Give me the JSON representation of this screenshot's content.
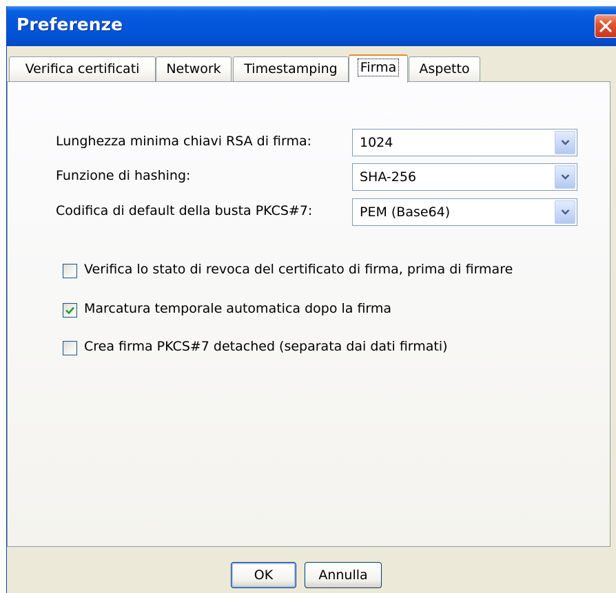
{
  "window": {
    "title": "Preferenze"
  },
  "tabs": [
    {
      "label": "Verifica certificati",
      "active": false
    },
    {
      "label": "Network",
      "active": false
    },
    {
      "label": "Timestamping",
      "active": false
    },
    {
      "label": "Firma",
      "active": true
    },
    {
      "label": "Aspetto",
      "active": false
    }
  ],
  "form": {
    "rsa_min_length": {
      "label": "Lunghezza minima chiavi RSA di firma:",
      "value": "1024"
    },
    "hashing": {
      "label": "Funzione di hashing:",
      "value": "SHA-256"
    },
    "pkcs7_encoding": {
      "label": "Codifica di default della busta PKCS#7:",
      "value": "PEM (Base64)"
    }
  },
  "options": [
    {
      "label": "Verifica lo stato di revoca del certificato di firma, prima di firmare",
      "checked": false
    },
    {
      "label": "Marcatura temporale automatica dopo la firma",
      "checked": true
    },
    {
      "label": "Crea firma PKCS#7 detached (separata dai dati firmati)",
      "checked": false
    }
  ],
  "buttons": {
    "ok": "OK",
    "cancel": "Annulla"
  },
  "icons": {
    "close": "close-icon",
    "dropdown": "chevron-down-icon",
    "check": "checkmark-icon"
  },
  "colors": {
    "titlebar": "#0456db",
    "close": "#e2522f",
    "active_tab_accent": "#e68b2c",
    "check": "#21a121"
  }
}
